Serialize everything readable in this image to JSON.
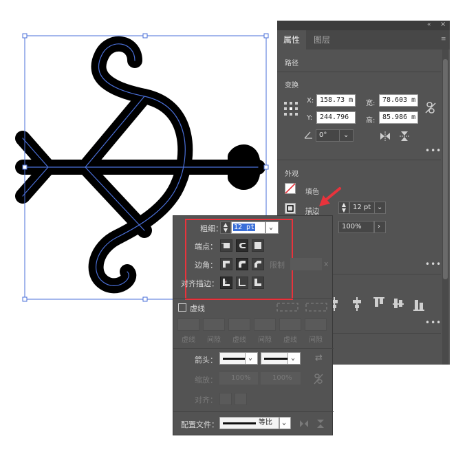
{
  "panel": {
    "tabs": [
      "属性",
      "图层"
    ],
    "section_path": "路径",
    "transform": {
      "title": "变换",
      "x_label": "X:",
      "x_value": "158.73 m",
      "y_label": "Y:",
      "y_value": "244.796",
      "w_label": "宽:",
      "w_value": "78.603 m",
      "h_label": "高:",
      "h_value": "85.986 m",
      "angle_value": "0°"
    },
    "appearance": {
      "title": "外观",
      "fill_label": "填色",
      "stroke_label": "描边",
      "stroke_weight": "12 pt",
      "opacity": "100%"
    },
    "more_dots": "•••"
  },
  "stroke_popup": {
    "weight_label": "粗细：",
    "weight_value": "12 pt",
    "cap_label": "端点：",
    "corner_label": "边角：",
    "limit_label": "限制",
    "limit_unit": "x",
    "align_label": "对齐描边：",
    "dashed_label": "虚线",
    "dash_labels": [
      "虚线",
      "间隙",
      "虚线",
      "间隙",
      "虚线",
      "间隙"
    ],
    "arrow_label": "箭头：",
    "scale_label": "缩放：",
    "scale_value_1": "100%",
    "scale_value_2": "100%",
    "align_arrow_label": "对齐：",
    "profile_label": "配置文件：",
    "profile_value": "等比"
  },
  "colors": {
    "panel_bg": "#535353",
    "highlight": "#e8333c",
    "selection": "#4a6fd8",
    "artwork": "#000000"
  }
}
